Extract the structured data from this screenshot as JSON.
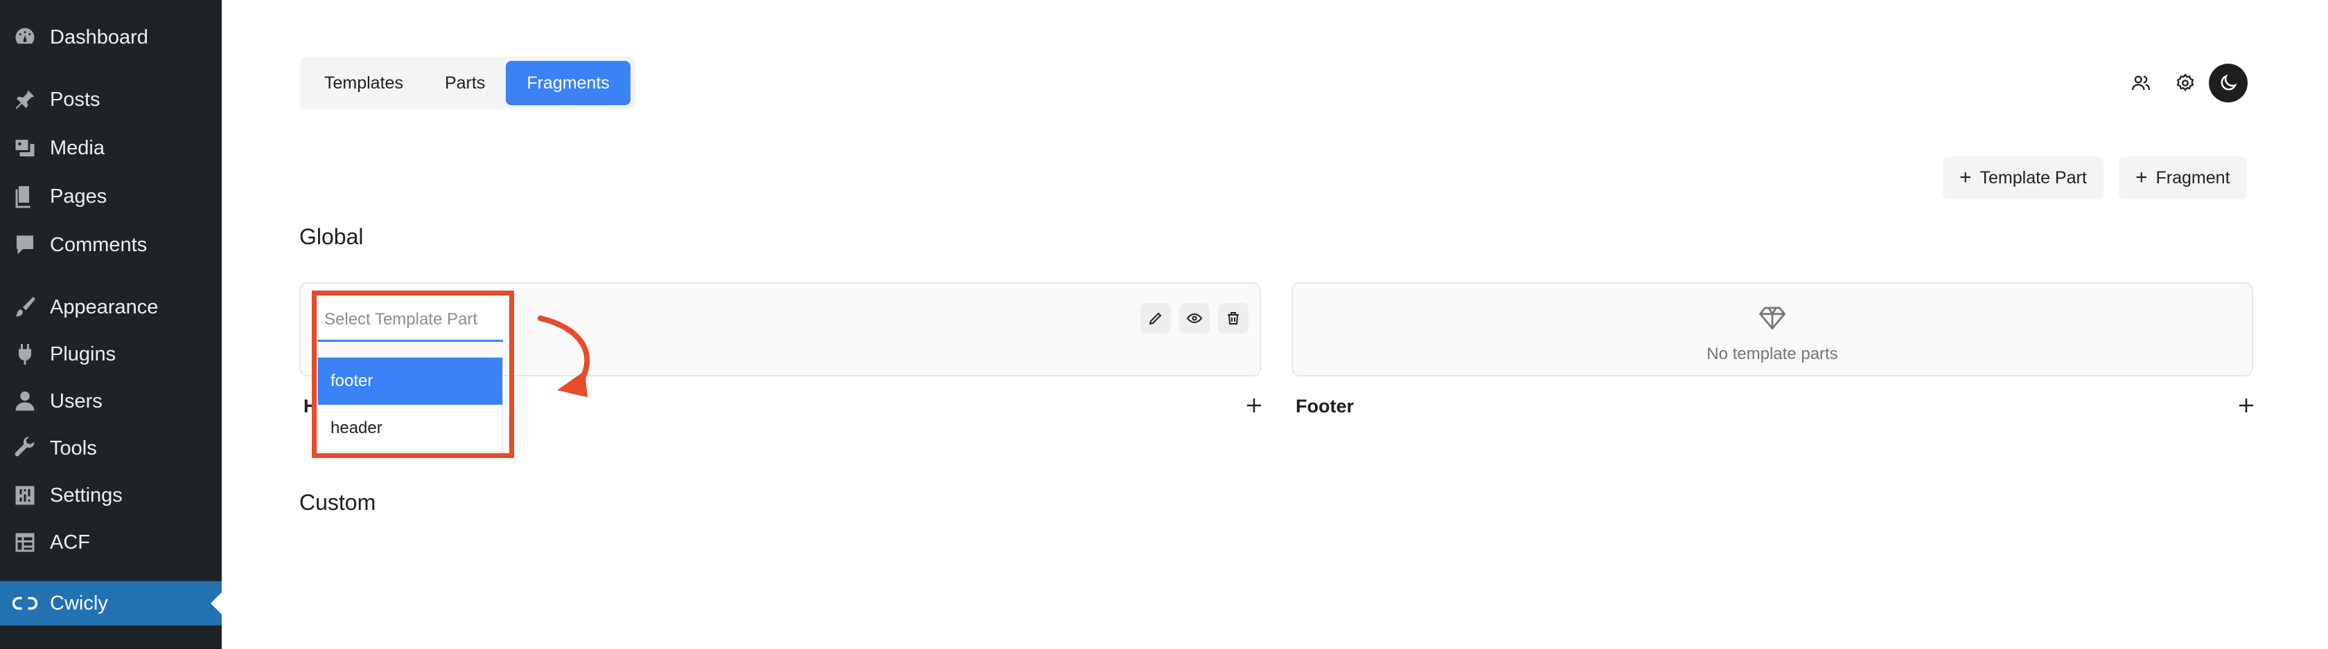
{
  "sidebar": {
    "items": [
      {
        "label": "Dashboard",
        "icon": "dashboard-icon"
      },
      {
        "label": "Posts",
        "icon": "pushpin-icon"
      },
      {
        "label": "Media",
        "icon": "media-icon"
      },
      {
        "label": "Pages",
        "icon": "pages-icon"
      },
      {
        "label": "Comments",
        "icon": "comment-icon"
      },
      {
        "label": "Appearance",
        "icon": "paintbrush-icon"
      },
      {
        "label": "Plugins",
        "icon": "plugin-icon"
      },
      {
        "label": "Users",
        "icon": "user-icon"
      },
      {
        "label": "Tools",
        "icon": "wrench-icon"
      },
      {
        "label": "Settings",
        "icon": "settings-icon"
      },
      {
        "label": "ACF",
        "icon": "table-icon"
      },
      {
        "label": "Cwicly",
        "icon": "link-icon"
      }
    ]
  },
  "tabs": [
    "Templates",
    "Parts",
    "Fragments"
  ],
  "actions": {
    "template_part": "Template Part",
    "fragment": "Fragment"
  },
  "sections": {
    "global": "Global",
    "custom": "Custom"
  },
  "cards": {
    "header": {
      "label": "Header",
      "placeholder": "Select Template Part",
      "options": [
        "footer",
        "header"
      ]
    },
    "footer": {
      "label": "Footer",
      "empty_text": "No template parts"
    }
  },
  "colors": {
    "sidebar_bg": "#1d2327",
    "active_menu": "#2271b1",
    "accent": "#3b82f6",
    "annotation": "#e74a2c"
  }
}
